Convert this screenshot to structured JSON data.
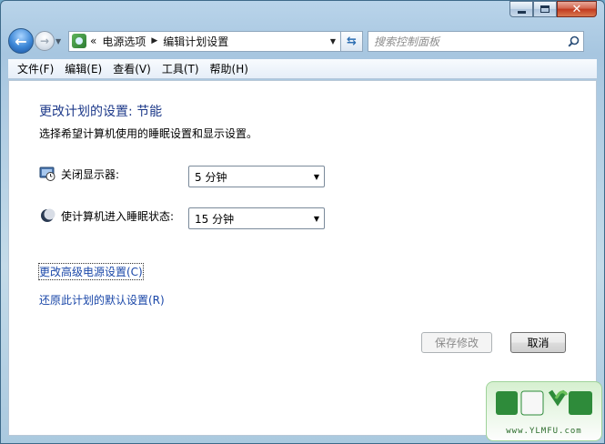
{
  "window": {
    "caption": {
      "minimize": "minimize",
      "maximize": "maximize",
      "close": "close"
    }
  },
  "nav": {
    "address_prefix": "«",
    "breadcrumb": [
      "电源选项",
      "编辑计划设置"
    ],
    "search_placeholder": "搜索控制面板"
  },
  "menu": {
    "items": [
      "文件(F)",
      "编辑(E)",
      "查看(V)",
      "工具(T)",
      "帮助(H)"
    ]
  },
  "main": {
    "title": "更改计划的设置: 节能",
    "subtitle": "选择希望计算机使用的睡眠设置和显示设置。",
    "settings": [
      {
        "label": "关闭显示器:",
        "value": "5 分钟"
      },
      {
        "label": "使计算机进入睡眠状态:",
        "value": "15 分钟"
      }
    ],
    "links": {
      "advanced": "更改高级电源设置(C)",
      "restore": "还原此计划的默认设置(R)"
    },
    "buttons": {
      "save": "保存修改",
      "cancel": "取消"
    }
  },
  "watermark": {
    "url": "www.YLMFU.com"
  },
  "colors": {
    "accent": "#1e3a8a",
    "link": "#1a47a8",
    "close": "#c0391f"
  }
}
